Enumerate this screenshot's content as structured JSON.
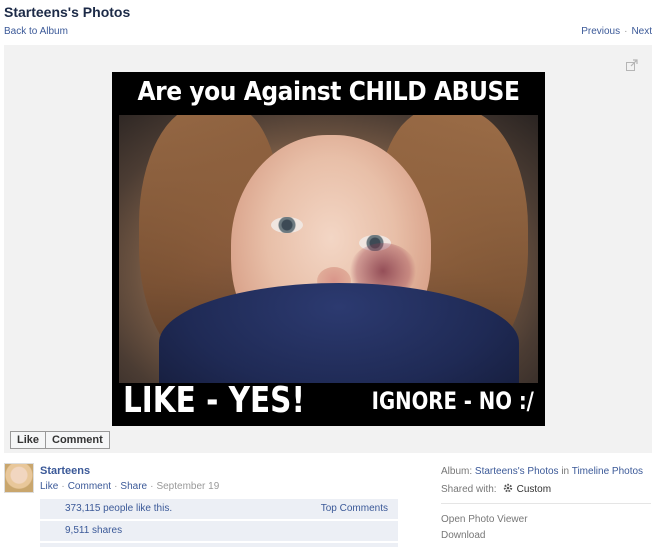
{
  "header": {
    "title": "Starteens's Photos",
    "back_link": "Back to Album",
    "previous": "Previous",
    "next": "Next",
    "separator": "·"
  },
  "photo": {
    "caption_top": "Are you Against CHILD ABUSE",
    "caption_bottom_left": "LIKE - YES!",
    "caption_bottom_right": "IGNORE - NO :/"
  },
  "actions": {
    "like": "Like",
    "comment": "Comment"
  },
  "post": {
    "author": "Starteens",
    "like": "Like",
    "comment": "Comment",
    "share": "Share",
    "date": "September 19",
    "likes_text": "373,115 people like this.",
    "top_comments": "Top Comments",
    "shares_text": "9,511 shares"
  },
  "sidebar": {
    "album_label": "Album:",
    "album_name": "Starteens's Photos",
    "album_in": "in",
    "album_parent": "Timeline Photos",
    "shared_label": "Shared with:",
    "shared_value": "Custom",
    "open_viewer": "Open Photo Viewer",
    "download": "Download"
  },
  "icons": {
    "expand": "expand-icon",
    "gear": "gear-icon"
  },
  "colors": {
    "link": "#3b5998",
    "stage_bg": "#f2f2f2",
    "ufi_bg": "#eceff5"
  }
}
